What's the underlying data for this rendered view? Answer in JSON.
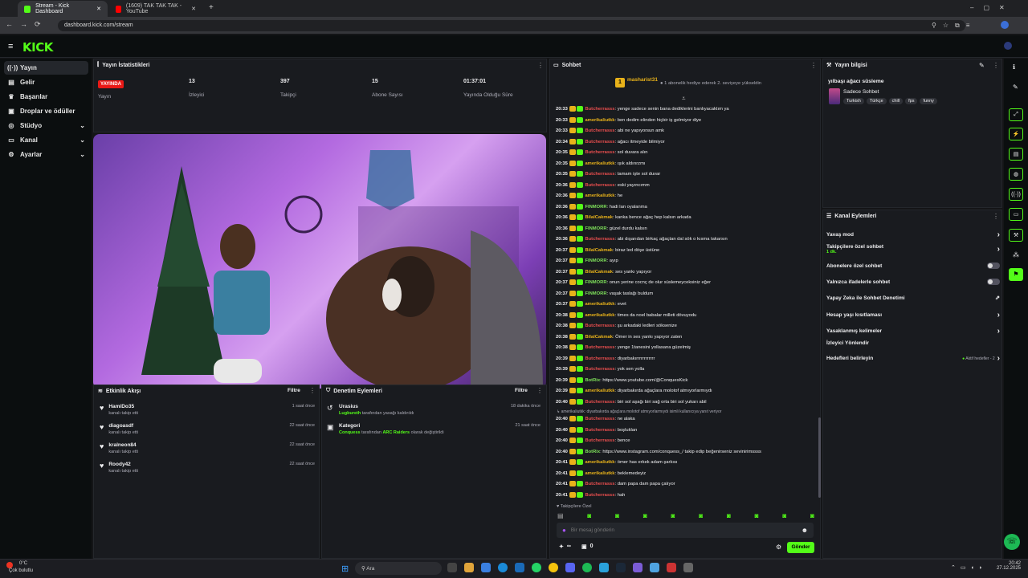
{
  "browser": {
    "tabs": [
      {
        "title": "Stream - Kick Dashboard"
      },
      {
        "title": "(1609) TAK TAK TAK - YouTube"
      }
    ],
    "url": "dashboard.kick.com/stream"
  },
  "brand": {
    "logo": "KICK",
    "accent": "#53fc18"
  },
  "sidebar": {
    "items": [
      {
        "label": "Yayın",
        "icon": "broadcast-icon"
      },
      {
        "label": "Gelir",
        "icon": "revenue-icon"
      },
      {
        "label": "Başarılar",
        "icon": "achievements-icon"
      },
      {
        "label": "Droplar ve ödüller",
        "icon": "gift-icon"
      },
      {
        "label": "Stüdyo",
        "icon": "studio-icon"
      },
      {
        "label": "Kanal",
        "icon": "channel-icon"
      },
      {
        "label": "Ayarlar",
        "icon": "settings-icon"
      }
    ]
  },
  "stats": {
    "title": "Yayın İstatistikleri",
    "live_badge": "YAYINDA",
    "items": [
      {
        "value": "",
        "label": "Yayın"
      },
      {
        "value": "13",
        "label": "İzleyici"
      },
      {
        "value": "397",
        "label": "Takipçi"
      },
      {
        "value": "15",
        "label": "Abone Sayısı"
      },
      {
        "value": "01:37:01",
        "label": "Yayında Olduğu Süre"
      }
    ]
  },
  "activity": {
    "title": "Etkinlik Akışı",
    "filter": "Filtre",
    "items": [
      {
        "name": "HamiDo35",
        "sub": "kanalı takip etti",
        "time": "1 saat önce"
      },
      {
        "name": "diagoasdf",
        "sub": "kanalı takip etti",
        "time": "22 saat önce"
      },
      {
        "name": "kralneon84",
        "sub": "kanalı takip etti",
        "time": "22 saat önce"
      },
      {
        "name": "Roody42",
        "sub": "kanalı takip etti",
        "time": "22 saat önce"
      }
    ]
  },
  "moderation": {
    "title": "Denetim Eylemleri",
    "filter": "Filtre",
    "items": [
      {
        "title": "Urasius",
        "user": "Lugbureth",
        "rest": "tarafından yasağı kaldırıldı",
        "time": "18 dakika önce"
      },
      {
        "title": "Kategori",
        "user": "Conquess",
        "mid": "tarafından",
        "target": "ARC Raiders",
        "rest": "olarak değiştirildi",
        "time": "21 saat önce"
      }
    ]
  },
  "chat": {
    "title": "Sohbet",
    "pinned_user": "masharist31",
    "pinned_count": "1",
    "pinned_text": "1 abonelik hediye ederek 2. seviyeye yükseldin",
    "messages": [
      {
        "t": "20:33",
        "u": "Butcherrasss",
        "c": "#e94e4e",
        "m": ": yenge sadece senin bana dediklerini banlıyacaktım ya"
      },
      {
        "t": "20:33",
        "u": "amerikaliutkk",
        "c": "#e8b21a",
        "m": ": ben dedim elinden hiçbir iş gelmiyor diye"
      },
      {
        "t": "20:33",
        "u": "Butcherrasss",
        "c": "#e94e4e",
        "m": ": abi ne yapıyorsun amk"
      },
      {
        "t": "20:34",
        "u": "Butcherrasss",
        "c": "#e94e4e",
        "m": ": ağacı itmeyide bilmiyor"
      },
      {
        "t": "20:35",
        "u": "Butcherrasss",
        "c": "#e94e4e",
        "m": ": sol duvara alın"
      },
      {
        "t": "20:35",
        "u": "amerikaliutkk",
        "c": "#e8b21a",
        "m": ": ışık aldırırzmı"
      },
      {
        "t": "20:35",
        "u": "Butcherrasss",
        "c": "#e94e4e",
        "m": ": tamam işte sol duvar"
      },
      {
        "t": "20:36",
        "u": "Butcherrasss",
        "c": "#e94e4e",
        "m": ": eski yayıncımm"
      },
      {
        "t": "20:36",
        "u": "amerikaliutkk",
        "c": "#e8b21a",
        "m": ": he"
      },
      {
        "t": "20:36",
        "u": "FINMORR",
        "c": "#7ee05a",
        "m": ": hadi lan oyalanma"
      },
      {
        "t": "20:36",
        "u": "BilalCakmak",
        "c": "#e8b21a",
        "m": ": kanka bence ağaç hep kalsın arkada"
      },
      {
        "t": "20:36",
        "u": "FINMORR",
        "c": "#7ee05a",
        "m": ": güzel durdu kalsın"
      },
      {
        "t": "20:36",
        "u": "Butcherrasss",
        "c": "#e94e4e",
        "m": ": abi dışarıdan birkaç ağaçtan dal sök o kısma takarsın"
      },
      {
        "t": "20:37",
        "u": "BilalCakmak",
        "c": "#e8b21a",
        "m": ": biraz led döşe üstüne"
      },
      {
        "t": "20:37",
        "u": "FINMORR",
        "c": "#7ee05a",
        "m": ": ayıp"
      },
      {
        "t": "20:37",
        "u": "BilalCakmak",
        "c": "#e8b21a",
        "m": ": ses yankı yapıyor"
      },
      {
        "t": "20:37",
        "u": "FINMORR",
        "c": "#7ee05a",
        "m": ": onun yerine cocnç de olur süslemeyceksiniz eğer"
      },
      {
        "t": "20:37",
        "u": "FINMORR",
        "c": "#7ee05a",
        "m": ": vaşak taslağı buldum"
      },
      {
        "t": "20:37",
        "u": "amerikaliutkk",
        "c": "#e8b21a",
        "m": ": evet"
      },
      {
        "t": "20:38",
        "u": "amerikaliutkk",
        "c": "#e8b21a",
        "m": ": times da noel babalar milleti dövuyodu"
      },
      {
        "t": "20:38",
        "u": "Butcherrasss",
        "c": "#e94e4e",
        "m": ": şu arkadaki ledleri söksenize"
      },
      {
        "t": "20:38",
        "u": "BilalCakmak",
        "c": "#e8b21a",
        "m": ": Ömer in ses yankı yapıyor zaten"
      },
      {
        "t": "20:38",
        "u": "Butcherrasss",
        "c": "#e94e4e",
        "m": ": yenge 1tanesini yollasana güzelmiş"
      },
      {
        "t": "20:39",
        "u": "Butcherrasss",
        "c": "#e94e4e",
        "m": ": diyarbakırrrrrrrrrrrr"
      },
      {
        "t": "20:39",
        "u": "Butcherrasss",
        "c": "#e94e4e",
        "m": ": yok sen yolla"
      },
      {
        "t": "20:39",
        "u": "BotRix",
        "c": "#7ee05a",
        "m": ": https://www.youtube.com/@ConquesKick"
      },
      {
        "t": "20:39",
        "u": "amerikaliutkk",
        "c": "#e8b21a",
        "m": ": diyarbakırda ağaçlara molotof atmıyorlarmıydı"
      },
      {
        "t": "20:40",
        "u": "Butcherrasss",
        "c": "#e94e4e",
        "m": ": biri sol aşağı biri sağ orta biri sol yukarı abil"
      }
    ],
    "reply_note": "amerikaliutkk: diyarbakırda ağaçlara molotof atmıyorlarmıydı isimli kullanıcıya yanıt veriyor",
    "messages2": [
      {
        "t": "20:40",
        "u": "Butcherrasss",
        "c": "#e94e4e",
        "m": ": ne alaka"
      },
      {
        "t": "20:40",
        "u": "Butcherrasss",
        "c": "#e94e4e",
        "m": ": boşlukları"
      },
      {
        "t": "20:40",
        "u": "Butcherrasss",
        "c": "#e94e4e",
        "m": ": bence"
      },
      {
        "t": "20:40",
        "u": "BotRix",
        "c": "#7ee05a",
        "m": ": https://www.instagram.com/conquess_/ takip edip beğenirseniz sevinirimssss"
      },
      {
        "t": "20:41",
        "u": "amerikaliutkk",
        "c": "#e8b21a",
        "m": ": ömer has erkek adam şarkısı"
      },
      {
        "t": "20:41",
        "u": "amerikaliutkk",
        "c": "#e8b21a",
        "m": ": beklemedeyiz"
      },
      {
        "t": "20:41",
        "u": "Butcherrasss",
        "c": "#e94e4e",
        "m": ": dam papa dam papa çalıyor"
      },
      {
        "t": "20:41",
        "u": "Butcherrasss",
        "c": "#e94e4e",
        "m": ": hah"
      }
    ],
    "followers_only": "Takipçilere Özel",
    "placeholder": "Bir mesaj gönderin",
    "counter1": "∞",
    "counter2": "0",
    "send": "Gönder"
  },
  "stream_info": {
    "title": "Yayın bilgisi",
    "stream_title": "yılbaşı ağacı süsleme",
    "category": "Sadece Sohbet",
    "tags": [
      "Turkish",
      "Türkçe",
      "chill",
      "fps",
      "funny"
    ]
  },
  "channel_actions": {
    "title": "Kanal Eylemleri",
    "items": [
      {
        "label": "Yavaş mod",
        "type": "chevron"
      },
      {
        "label": "Takipçilere özel sohbet",
        "sub": "1 dk.",
        "type": "chevron"
      },
      {
        "label": "Abonelere özel sohbet",
        "type": "toggle"
      },
      {
        "label": "Yalnızca ifadelerle sohbet",
        "type": "toggle"
      },
      {
        "label": "Yapay Zeka ile Sohbet Denetimi",
        "type": "external"
      },
      {
        "label": "Hesap yaşı kısıtlaması",
        "type": "chevron"
      },
      {
        "label": "Yasaklanmış kelimeler",
        "type": "chevron"
      },
      {
        "label": "İzleyici Yönlendir",
        "type": "none"
      },
      {
        "label": "Hedefleri belirleyin",
        "badge": "Aktif hedefler - 2",
        "type": "chevron"
      }
    ]
  },
  "taskbar": {
    "weather_temp": "0°C",
    "weather_desc": "Çok bulutlu",
    "search": "Ara",
    "time": "20:42",
    "date": "27.12.2025"
  }
}
